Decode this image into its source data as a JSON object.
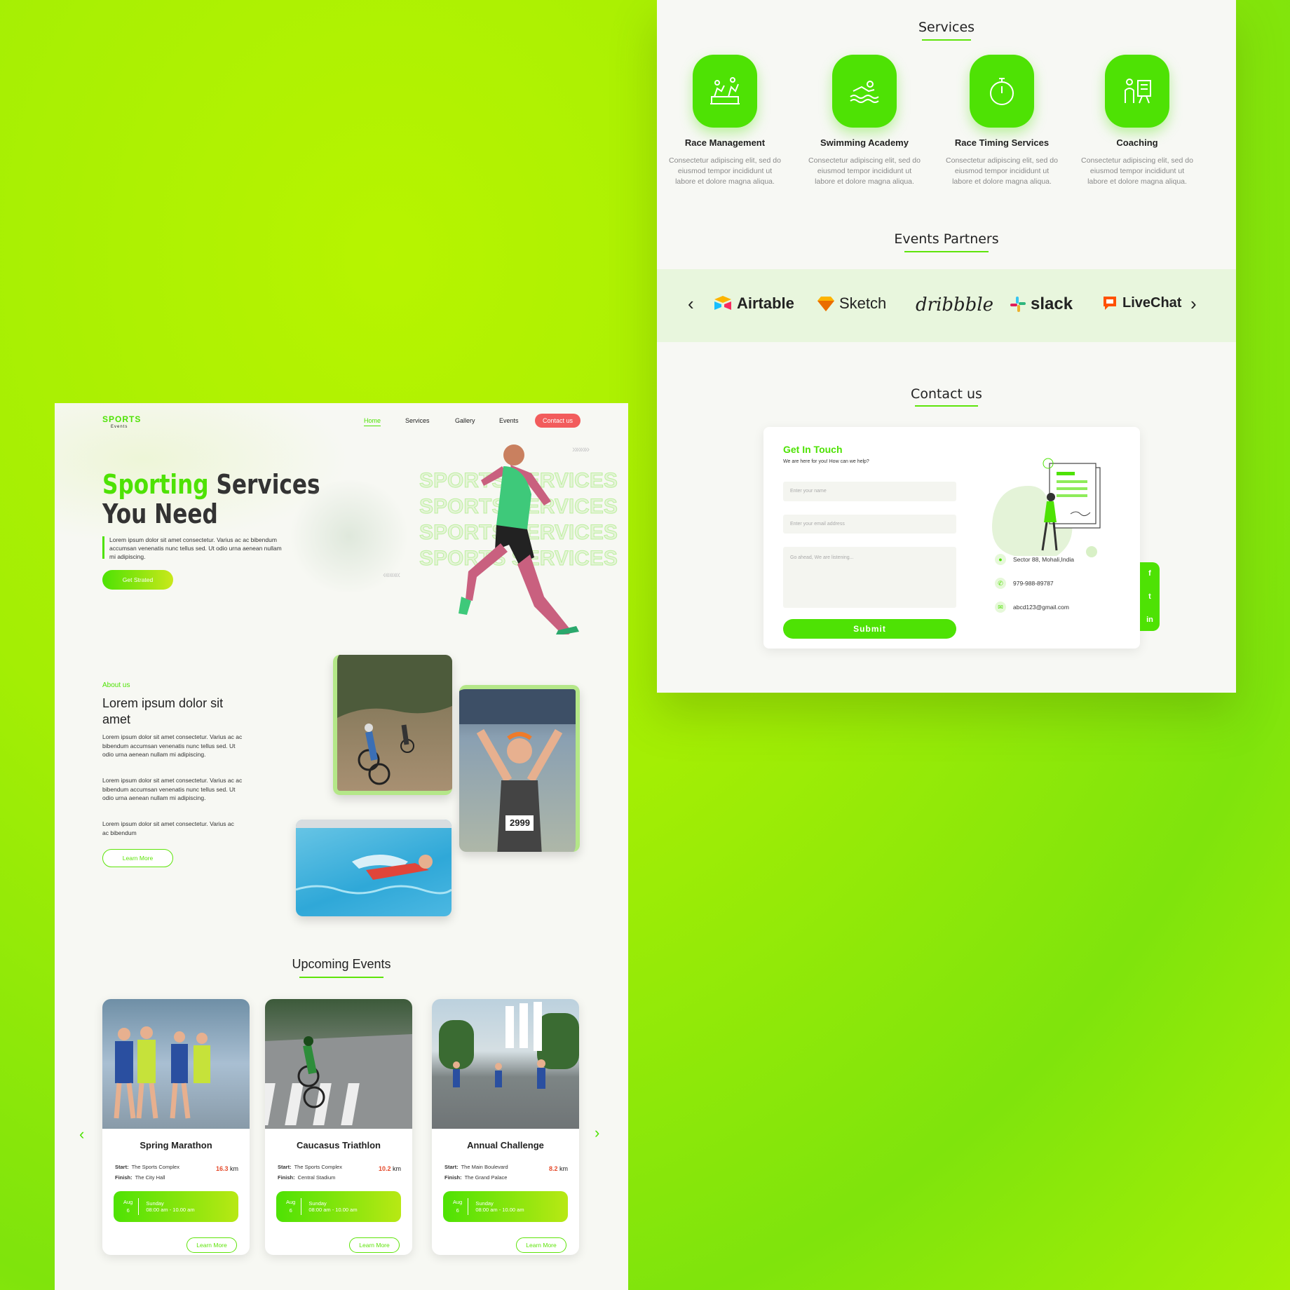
{
  "services_section": {
    "title": "Services",
    "items": [
      {
        "name": "Race Management",
        "desc": "Consectetur adipiscing elit, sed do eiusmod tempor incididunt ut labore et dolore magna aliqua.",
        "icon": "race-management-icon"
      },
      {
        "name": "Swimming Academy",
        "desc": "Consectetur adipiscing elit, sed do eiusmod tempor incididunt ut labore et dolore magna aliqua.",
        "icon": "swimmer-icon"
      },
      {
        "name": "Race Timing Services",
        "desc": "Consectetur adipiscing elit, sed do eiusmod tempor incididunt ut labore et dolore magna aliqua.",
        "icon": "stopwatch-icon"
      },
      {
        "name": "Coaching",
        "desc": "Consectetur adipiscing elit, sed do eiusmod tempor incididunt ut labore et dolore magna aliqua.",
        "icon": "coach-board-icon"
      }
    ]
  },
  "partners": {
    "title": "Events Partners",
    "logos": [
      "Airtable",
      "Sketch",
      "dribbble",
      "slack",
      "LiveChat"
    ]
  },
  "contact": {
    "title": "Contact us",
    "card_title": "Get In Touch",
    "card_subtitle": "We are here for you! How can we help?",
    "name_placeholder": "Enter your name",
    "email_placeholder": "Enter your email address",
    "message_placeholder": "Go ahead, We are listening...",
    "submit": "Submit",
    "address": "Sector 88, Mohali,India",
    "phone": "979-988-89787",
    "email": "abcd123@gmail.com",
    "social": [
      "f",
      "t",
      "in"
    ]
  },
  "brand": {
    "name": "SPORTS",
    "sub": "Events"
  },
  "nav": {
    "home": "Home",
    "services": "Services",
    "gallery": "Gallery",
    "events": "Events",
    "contact": "Contact us"
  },
  "hero": {
    "title_accent": "Sporting",
    "title_rest": "Services",
    "title_line2": "You Need",
    "text": "Lorem ipsum dolor sit amet consectetur. Varius ac ac bibendum accumsan venenatis nunc tellus sed. Ut odio urna aenean nullam mi adipiscing.",
    "cta": "Get Strated",
    "watermark": [
      "SPORTS SERVICES",
      "SPORTS SERVICES",
      "SPORTS SERVICES",
      "SPORTS SERVICES"
    ]
  },
  "about": {
    "eyebrow": "About us",
    "title": "Lorem ipsum dolor sit amet",
    "p1": "Lorem ipsum dolor sit amet consectetur. Varius ac ac bibendum accumsan venenatis nunc tellus sed. Ut odio urna aenean nullam mi adipiscing.",
    "p2": "Lorem ipsum dolor sit amet consectetur. Varius ac ac bibendum accumsan venenatis nunc tellus sed. Ut odio urna aenean nullam mi adipiscing.",
    "p3": "Lorem ipsum dolor sit amet consectetur. Varius ac ac bibendum",
    "cta": "Learn More",
    "bib": "2999"
  },
  "events": {
    "title": "Upcoming Events",
    "items": [
      {
        "title": "Spring Marathon",
        "start": "The Sports Complex",
        "finish": "The City Hall",
        "km": "16.3",
        "month": "Aug",
        "day": "6",
        "weekday": "Sunday",
        "time": "08:00 am - 10.00 am",
        "cta": "Learn More"
      },
      {
        "title": "Caucasus Triathlon",
        "start": "The Sports Complex",
        "finish": "Central Stadium",
        "km": "10.2",
        "month": "Aug",
        "day": "6",
        "weekday": "Sunday",
        "time": "08:00 am - 10.00 am",
        "cta": "Learn More"
      },
      {
        "title": "Annual Challenge",
        "start": "The Main Boulevard",
        "finish": "The Grand Palace",
        "km": "8.2",
        "month": "Aug",
        "day": "6",
        "weekday": "Sunday",
        "time": "08:00 am - 10.00 am",
        "cta": "Learn More"
      }
    ],
    "start_label": "Start:",
    "finish_label": "Finish:",
    "km_unit": "km"
  },
  "colors": {
    "accent": "#4ee204",
    "accent_light": "#e8f6dd",
    "km": "#e54a2b",
    "contact_btn": "#f25c5c"
  }
}
